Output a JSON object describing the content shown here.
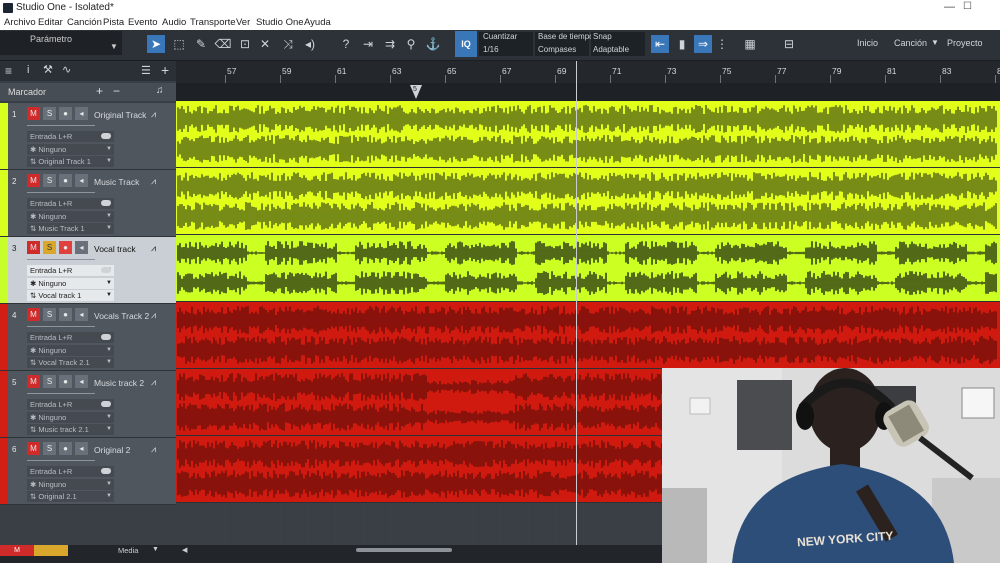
{
  "window": {
    "title": "Studio One - Isolated*"
  },
  "menu": [
    "Archivo",
    "Editar",
    "Canción",
    "Pista",
    "Evento",
    "Audio",
    "Transporte",
    "Ver",
    "Studio One",
    "Ayuda"
  ],
  "toolbar": {
    "parametro": "Parámetro",
    "quantize": {
      "iq": "IQ",
      "cuantizar_label": "Cuantizar",
      "cuantizar_value": "1/16",
      "base_label": "Base de tiempo",
      "base_value": "Compases",
      "snap_label": "Snap",
      "snap_value": "Adaptable"
    },
    "right_tabs": [
      "Inicio",
      "Canción",
      "Proyecto"
    ]
  },
  "ruler": {
    "bars": [
      "57",
      "59",
      "61",
      "63",
      "65",
      "67",
      "69",
      "71",
      "73",
      "75",
      "77",
      "79",
      "81",
      "83",
      "8"
    ],
    "marker": "5"
  },
  "marker_lane": {
    "label": "Marcador"
  },
  "tracks": [
    {
      "number": "1",
      "name": "Original Track",
      "input": "Entrada L+R",
      "send": "Ninguno",
      "version": "Original Track 1",
      "color": "#d8ff1e",
      "clip_color": "#e1ff18",
      "selected": false
    },
    {
      "number": "2",
      "name": "Music Track",
      "input": "Entrada L+R",
      "send": "Ninguno",
      "version": "Music Track 1",
      "color": "#d8ff1e",
      "clip_color": "#e1ff18",
      "selected": false
    },
    {
      "number": "3",
      "name": "Vocal track",
      "input": "Entrada L+R",
      "send": "Ninguno",
      "version": "Vocal track 1",
      "color": "#c8ff2a",
      "clip_color": "#ccff22",
      "selected": true
    },
    {
      "number": "4",
      "name": "Vocals Track 2",
      "input": "Entrada L+R",
      "send": "Ninguno",
      "version": "Vocal Track 2.1",
      "color": "#d21e14",
      "clip_color": "#d01a10",
      "selected": false
    },
    {
      "number": "5",
      "name": "Music track 2",
      "input": "Entrada L+R",
      "send": "Ninguno",
      "version": "Music track 2.1",
      "color": "#d21e14",
      "clip_color": "#d01a10",
      "selected": false
    },
    {
      "number": "6",
      "name": "Original 2",
      "input": "Entrada L+R",
      "send": "Ninguno",
      "version": "Original 2.1",
      "color": "#d21e14",
      "clip_color": "#d01a10",
      "selected": false
    }
  ],
  "buttons": {
    "mute": "M",
    "solo": "S"
  },
  "bottom": {
    "mute": "M",
    "media": "Media"
  },
  "webcam": {
    "shirt_text": "NEW YORK CITY"
  }
}
